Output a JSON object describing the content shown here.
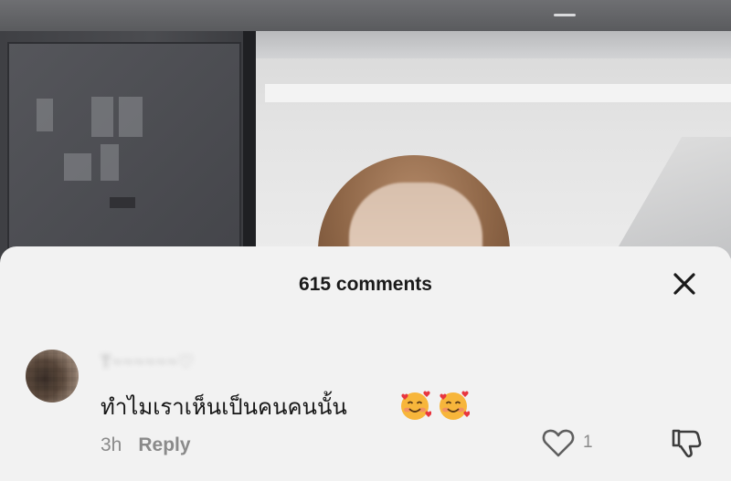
{
  "comments_panel": {
    "title": "615 comments",
    "close_icon": "close-icon"
  },
  "comment": {
    "username": "T~~~~~~♡",
    "text": "ทำไมเราเห็นเป็นคนคนนั้น",
    "emojis": [
      "smiling-face-with-hearts-icon",
      "smiling-face-with-hearts-icon"
    ],
    "time": "3h",
    "reply_label": "Reply",
    "like_count": "1",
    "like_icon": "heart-outline-icon",
    "dislike_icon": "thumbs-down-icon"
  },
  "colors": {
    "sheet_bg": "#f2f2f2",
    "text_primary": "#161616",
    "text_secondary": "#8a8a8a"
  }
}
